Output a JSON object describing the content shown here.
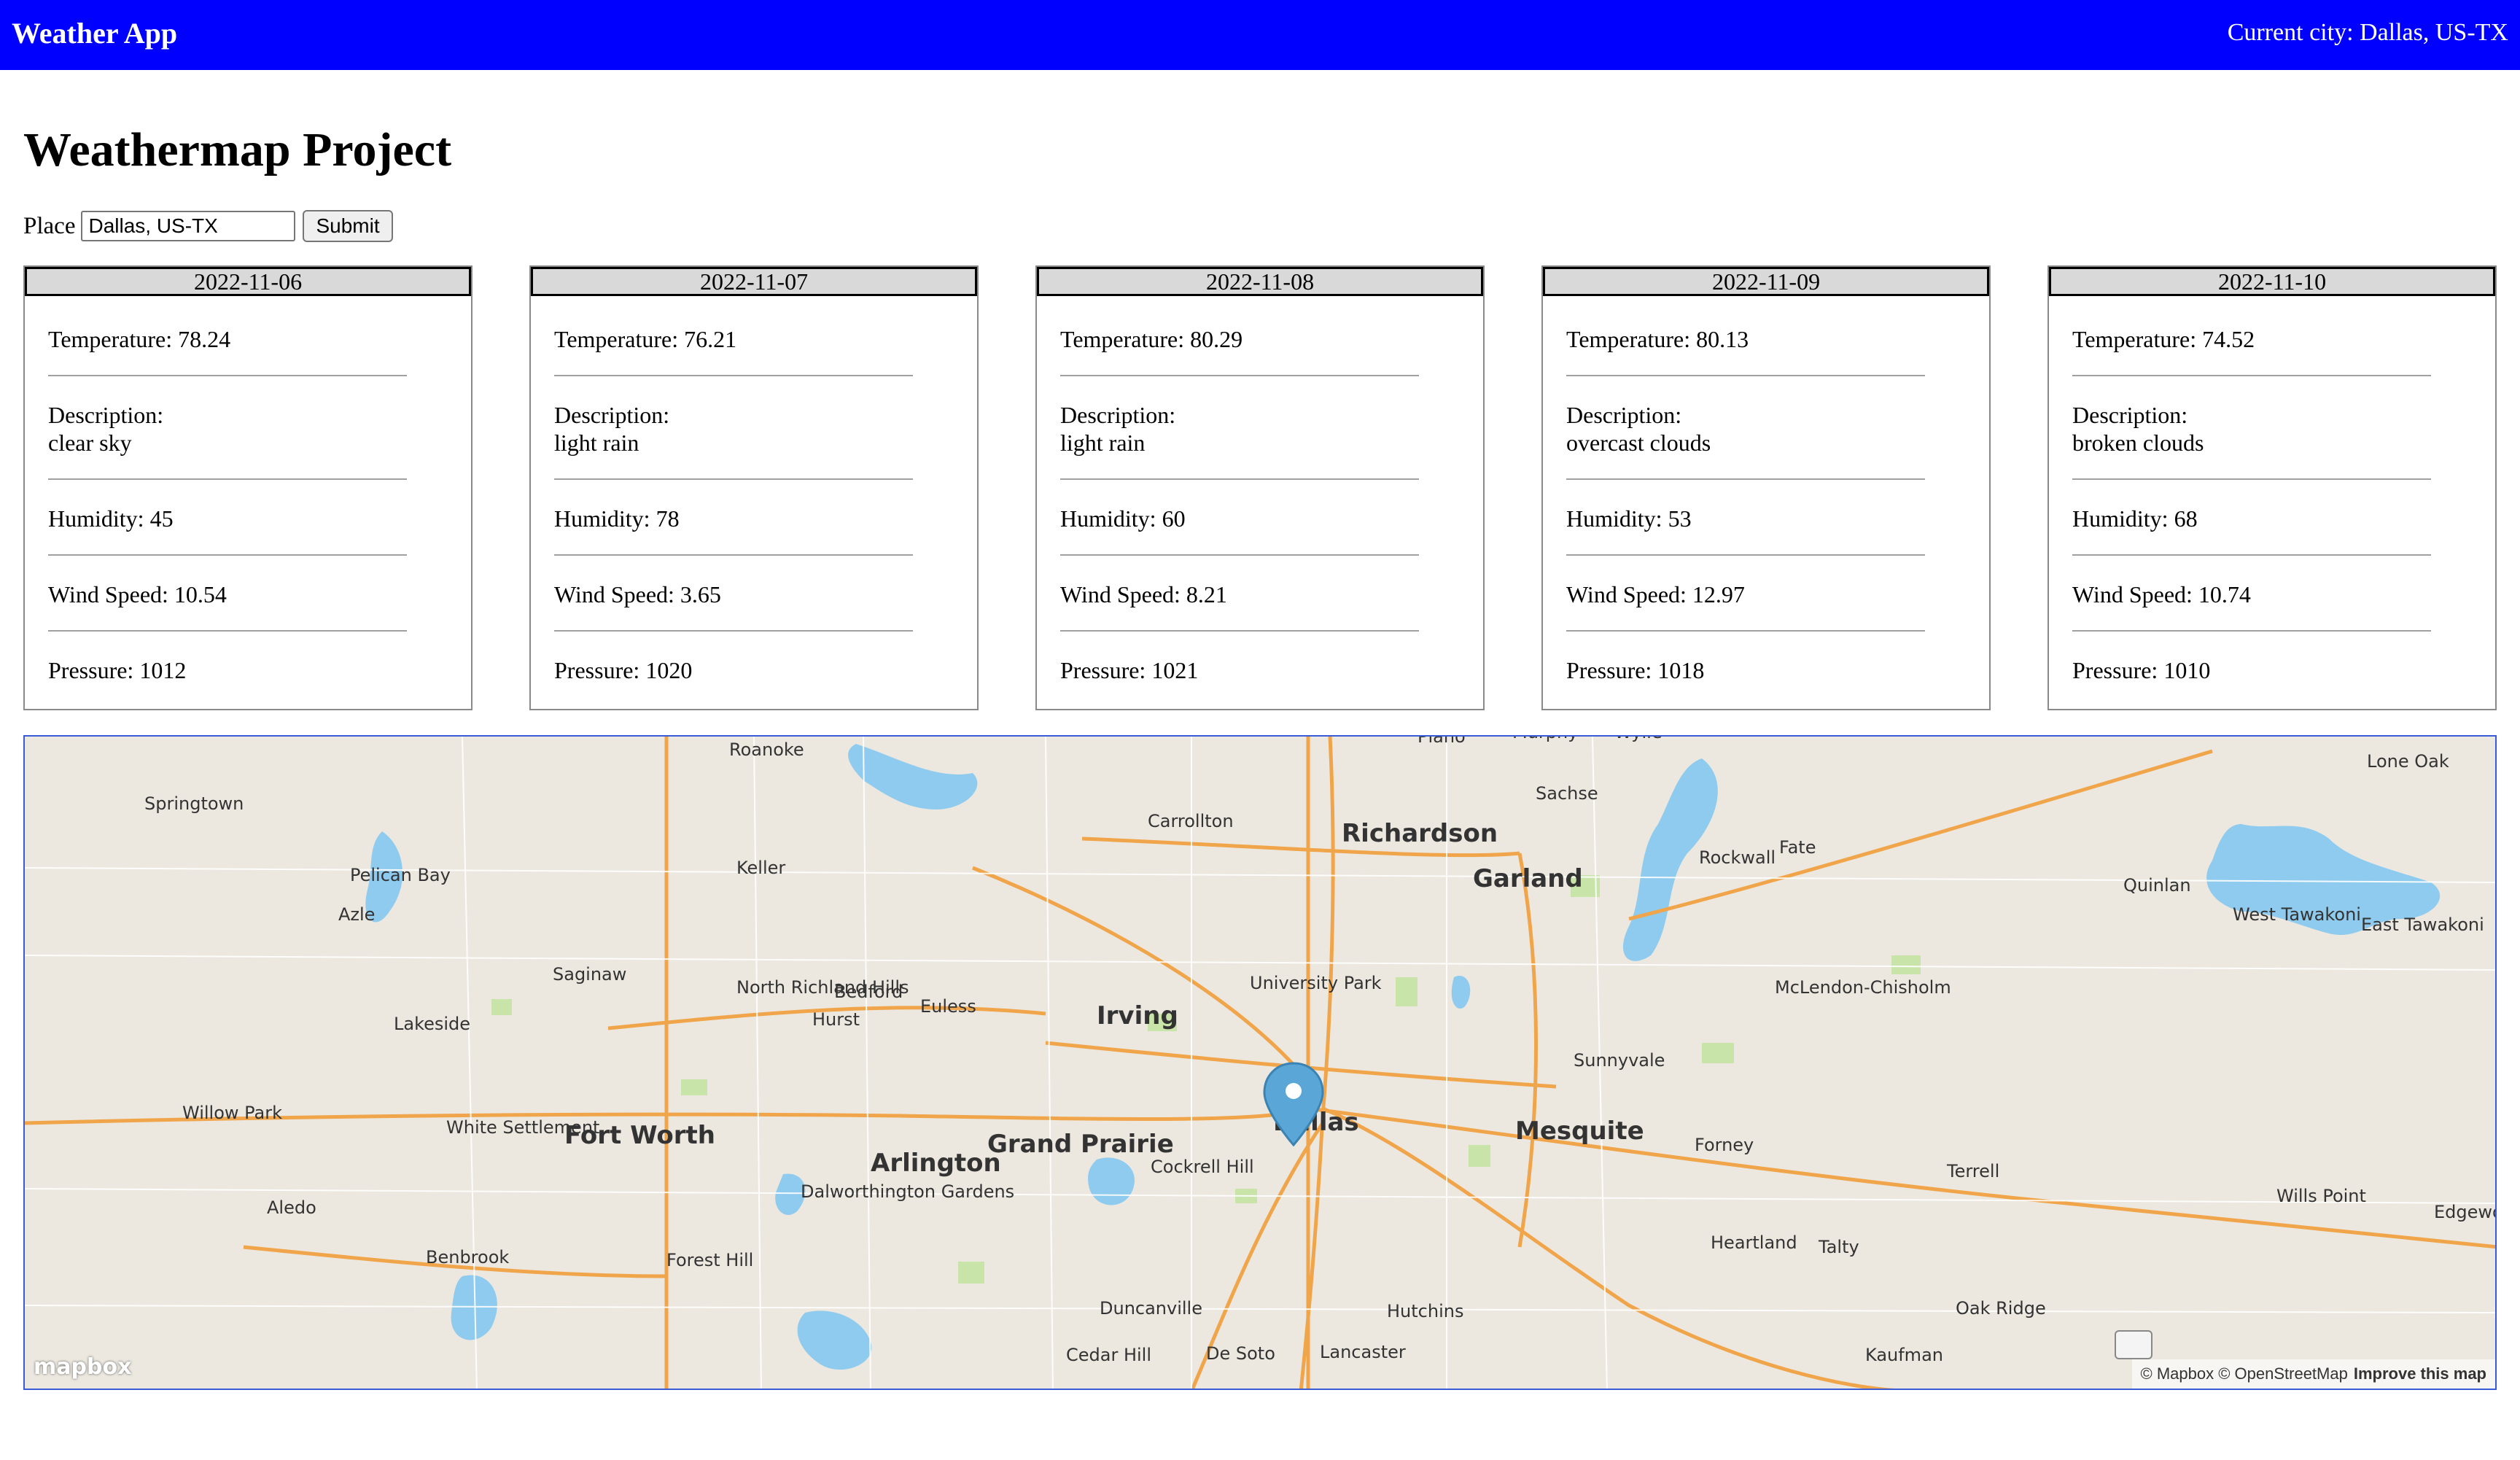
{
  "navbar": {
    "brand": "Weather App",
    "current_city": "Current city: Dallas, US-TX"
  },
  "page": {
    "title": "Weathermap Project"
  },
  "search": {
    "label": "Place",
    "value": "Dallas, US-TX",
    "submit_label": "Submit"
  },
  "forecast": [
    {
      "date": "2022-11-06",
      "temperature": "Temperature: 78.24",
      "description_label": "Description:",
      "description": "clear sky",
      "humidity": "Humidity: 45",
      "wind_speed": "Wind Speed: 10.54",
      "pressure": "Pressure: 1012"
    },
    {
      "date": "2022-11-07",
      "temperature": "Temperature: 76.21",
      "description_label": "Description:",
      "description": "light rain",
      "humidity": "Humidity: 78",
      "wind_speed": "Wind Speed: 3.65",
      "pressure": "Pressure: 1020"
    },
    {
      "date": "2022-11-08",
      "temperature": "Temperature: 80.29",
      "description_label": "Description:",
      "description": "light rain",
      "humidity": "Humidity: 60",
      "wind_speed": "Wind Speed: 8.21",
      "pressure": "Pressure: 1021"
    },
    {
      "date": "2022-11-09",
      "temperature": "Temperature: 80.13",
      "description_label": "Description:",
      "description": "overcast clouds",
      "humidity": "Humidity: 53",
      "wind_speed": "Wind Speed: 12.97",
      "pressure": "Pressure: 1018"
    },
    {
      "date": "2022-11-10",
      "temperature": "Temperature: 74.52",
      "description_label": "Description:",
      "description": "broken clouds",
      "humidity": "Humidity: 68",
      "wind_speed": "Wind Speed: 10.74",
      "pressure": "Pressure: 1010"
    }
  ],
  "map": {
    "cities_major": [
      "Fort Worth",
      "Dallas",
      "Arlington",
      "Grand Prairie",
      "Irving",
      "Garland",
      "Richardson",
      "Mesquite"
    ],
    "cities_minor": [
      "Plano",
      "Roanoke",
      "Springtown",
      "Keller",
      "Carrollton",
      "Sachse",
      "Rockwall",
      "Lone Oak",
      "Pelican Bay",
      "Azle",
      "Saginaw",
      "North Richland Hills",
      "Bedford",
      "Euless",
      "Hurst",
      "University Park",
      "Fate",
      "Quinlan",
      "West Tawakoni",
      "East Tawakoni",
      "McLendon-Chisholm",
      "Lakeside",
      "Sunnyvale",
      "White Settlement",
      "Willow Park",
      "Forney",
      "Terrell",
      "Aledo",
      "Cockrell Hill",
      "Dalworthington Gardens",
      "Wills Point",
      "Edgewood",
      "Benbrook",
      "Forest Hill",
      "Heartland",
      "Talty",
      "Oak Ridge",
      "Duncanville",
      "Hutchins",
      "Cedar Hill",
      "De Soto",
      "Lancaster",
      "Kaufman",
      "Murphy",
      "Wylie"
    ],
    "logo": "mapbox",
    "attribution": "© Mapbox © OpenStreetMap",
    "improve_link": "Improve this map",
    "colors": {
      "land": "#ece8e0",
      "water": "#8ecbee",
      "highway": "#f0a54a",
      "park": "#c9e4a8",
      "marker": "#5aa6d6"
    }
  }
}
